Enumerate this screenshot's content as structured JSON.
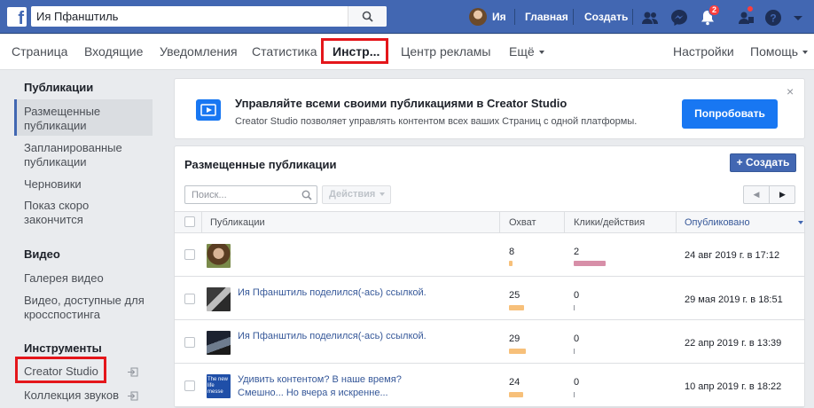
{
  "topbar": {
    "logo": "f",
    "search_value": "Ия Пфанштиль",
    "user_name": "Ия",
    "home_label": "Главная",
    "create_label": "Создать",
    "notifications_count": "2",
    "brand_color": "#4267b2"
  },
  "nav": {
    "items": [
      "Страница",
      "Входящие",
      "Уведомления",
      "Статистика",
      "Инстр...",
      "Центр рекламы",
      "Ещё",
      "Настройки",
      "Помощь"
    ],
    "active_index": 4
  },
  "sidebar": {
    "publications_title": "Публикации",
    "pub_items": [
      "Размещенные публикации",
      "Запланированные публикации",
      "Черновики",
      "Показ скоро закончится"
    ],
    "video_title": "Видео",
    "video_items": [
      "Галерея видео",
      "Видео, доступные для кросспостинга"
    ],
    "tools_title": "Инструменты",
    "tools_items": [
      "Creator Studio",
      "Коллекция звуков"
    ]
  },
  "banner": {
    "title": "Управляйте всеми своими публикациями в Creator Studio",
    "subtitle": "Creator Studio позволяет управлять контентом всех ваших Страниц с одной платформы.",
    "button": "Попробовать",
    "close": "×"
  },
  "panel": {
    "title": "Размещенные публикации",
    "create_button": "+ Создать",
    "search_placeholder": "Поиск...",
    "actions_button": "Действия",
    "pager_prev": "◀",
    "pager_next": "▶"
  },
  "table": {
    "headers": [
      "Публикации",
      "Охват",
      "Клики/действия",
      "Опубликовано"
    ],
    "rows": [
      {
        "text": "",
        "reach": "8",
        "reach_fraction": 0.1,
        "clicks": "2",
        "clicks_fraction": 1.0,
        "date": "24 авг 2019 г. в 17:12"
      },
      {
        "text": "Ия Пфанштиль поделился(-ась) ссылкой.",
        "reach": "25",
        "reach_fraction": 0.55,
        "clicks": "0",
        "clicks_fraction": 0,
        "date": "29 мая 2019 г. в 18:51"
      },
      {
        "text": "Ия Пфанштиль поделился(-ась) ссылкой.",
        "reach": "29",
        "reach_fraction": 0.62,
        "clicks": "0",
        "clicks_fraction": 0,
        "date": "22 апр 2019 г. в 13:39"
      },
      {
        "text": "Удивить контентом? В наше время? Смешно... Но вчера я искренне...",
        "reach": "24",
        "reach_fraction": 0.52,
        "clicks": "0",
        "clicks_fraction": 0,
        "date": "10 апр 2019 г. в 18:22"
      }
    ]
  },
  "thumb_label": "The new life messe"
}
